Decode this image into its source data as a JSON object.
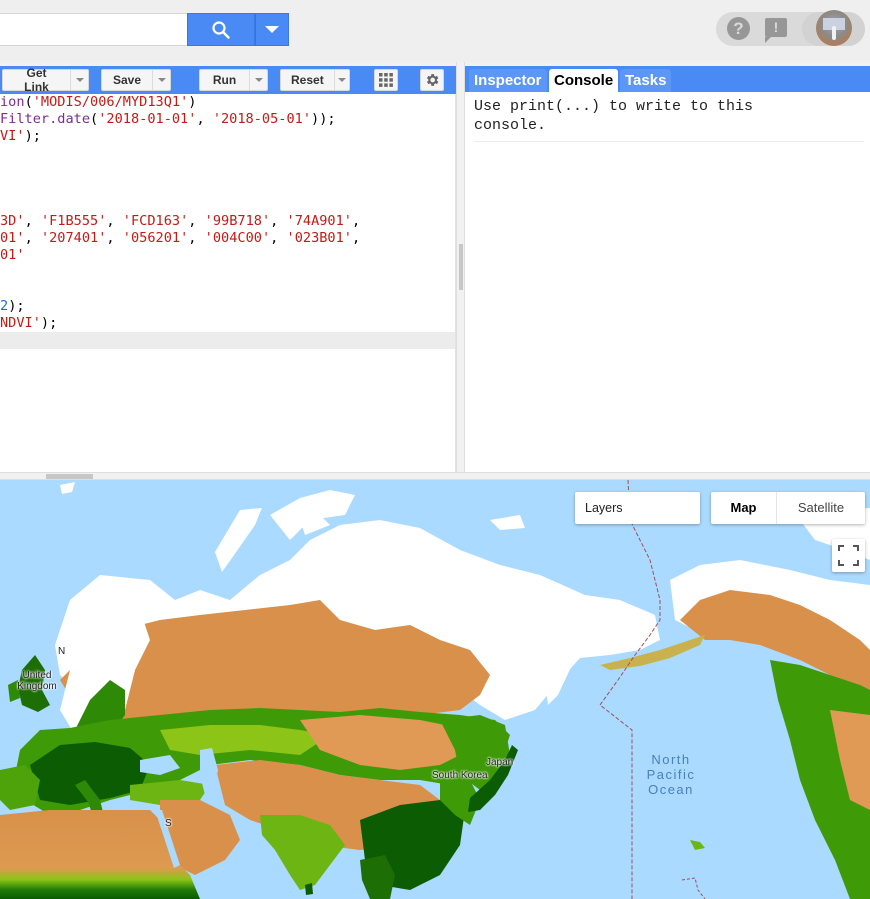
{
  "topbar": {
    "search_placeholder": "",
    "search_value": "",
    "search_icon": "search-icon",
    "dropdown_icon": "chevron-down-icon",
    "help_icon_glyph": "?",
    "feedback_icon_glyph": "!",
    "avatar": "user-avatar"
  },
  "editor": {
    "toolbar": {
      "get_link_label": "Get Link",
      "save_label": "Save",
      "run_label": "Run",
      "reset_label": "Reset",
      "apps_icon": "grid-icon",
      "settings_icon": "gear-icon"
    },
    "lines": [
      [
        {
          "t": "ion",
          "c": "fn"
        },
        {
          "t": "(",
          "c": ""
        },
        {
          "t": "'MODIS/006/MYD13Q1'",
          "c": "str"
        },
        {
          "t": ")",
          "c": ""
        }
      ],
      [
        {
          "t": "Filter.date",
          "c": "fn"
        },
        {
          "t": "(",
          "c": ""
        },
        {
          "t": "'2018-01-01'",
          "c": "str"
        },
        {
          "t": ", ",
          "c": ""
        },
        {
          "t": "'2018-05-01'",
          "c": "str"
        },
        {
          "t": "));",
          "c": ""
        }
      ],
      [
        {
          "t": "VI'",
          "c": "str"
        },
        {
          "t": ");",
          "c": ""
        }
      ],
      [],
      [],
      [],
      [],
      [
        {
          "t": "3D'",
          "c": "str"
        },
        {
          "t": ", ",
          "c": ""
        },
        {
          "t": "'F1B555'",
          "c": "str"
        },
        {
          "t": ", ",
          "c": ""
        },
        {
          "t": "'FCD163'",
          "c": "str"
        },
        {
          "t": ", ",
          "c": ""
        },
        {
          "t": "'99B718'",
          "c": "str"
        },
        {
          "t": ", ",
          "c": ""
        },
        {
          "t": "'74A901'",
          "c": "str"
        },
        {
          "t": ",",
          "c": ""
        }
      ],
      [
        {
          "t": "01'",
          "c": "str"
        },
        {
          "t": ", ",
          "c": ""
        },
        {
          "t": "'207401'",
          "c": "str"
        },
        {
          "t": ", ",
          "c": ""
        },
        {
          "t": "'056201'",
          "c": "str"
        },
        {
          "t": ", ",
          "c": ""
        },
        {
          "t": "'004C00'",
          "c": "str"
        },
        {
          "t": ", ",
          "c": ""
        },
        {
          "t": "'023B01'",
          "c": "str"
        },
        {
          "t": ",",
          "c": ""
        }
      ],
      [
        {
          "t": "01'",
          "c": "str"
        }
      ],
      [],
      [],
      [
        {
          "t": "2",
          "c": "num"
        },
        {
          "t": ");",
          "c": ""
        }
      ],
      [
        {
          "t": "NDVI'",
          "c": "str"
        },
        {
          "t": ");",
          "c": ""
        }
      ],
      []
    ],
    "active_line": 14
  },
  "right_panel": {
    "tabs": [
      {
        "label": "Inspector",
        "active": false
      },
      {
        "label": "Console",
        "active": true
      },
      {
        "label": "Tasks",
        "active": false
      }
    ],
    "console_text": "Use print(...) to write to this\nconsole."
  },
  "map": {
    "layers_label": "Layers",
    "map_type_selected": "Map",
    "map_type_other": "Satellite",
    "fullscreen_icon": "fullscreen-icon",
    "labels": [
      {
        "text": "N",
        "name": "label-norway"
      },
      {
        "text": "United Kingdom",
        "name": "label-united-kingdom"
      },
      {
        "text": "Japan",
        "name": "label-japan"
      },
      {
        "text": "South Korea",
        "name": "label-south-korea"
      },
      {
        "text": "S",
        "name": "label-saudi"
      }
    ],
    "ocean_label": "North Pacific Ocean",
    "colors": {
      "water": "#aadaff",
      "snow": "#ffffff",
      "bare": "#d9904a",
      "sparse": "#e8b860",
      "light_veg": "#8cc417",
      "veg": "#3f9a08",
      "dense_veg": "#0b5c02",
      "date_line": "#a0505a"
    }
  }
}
